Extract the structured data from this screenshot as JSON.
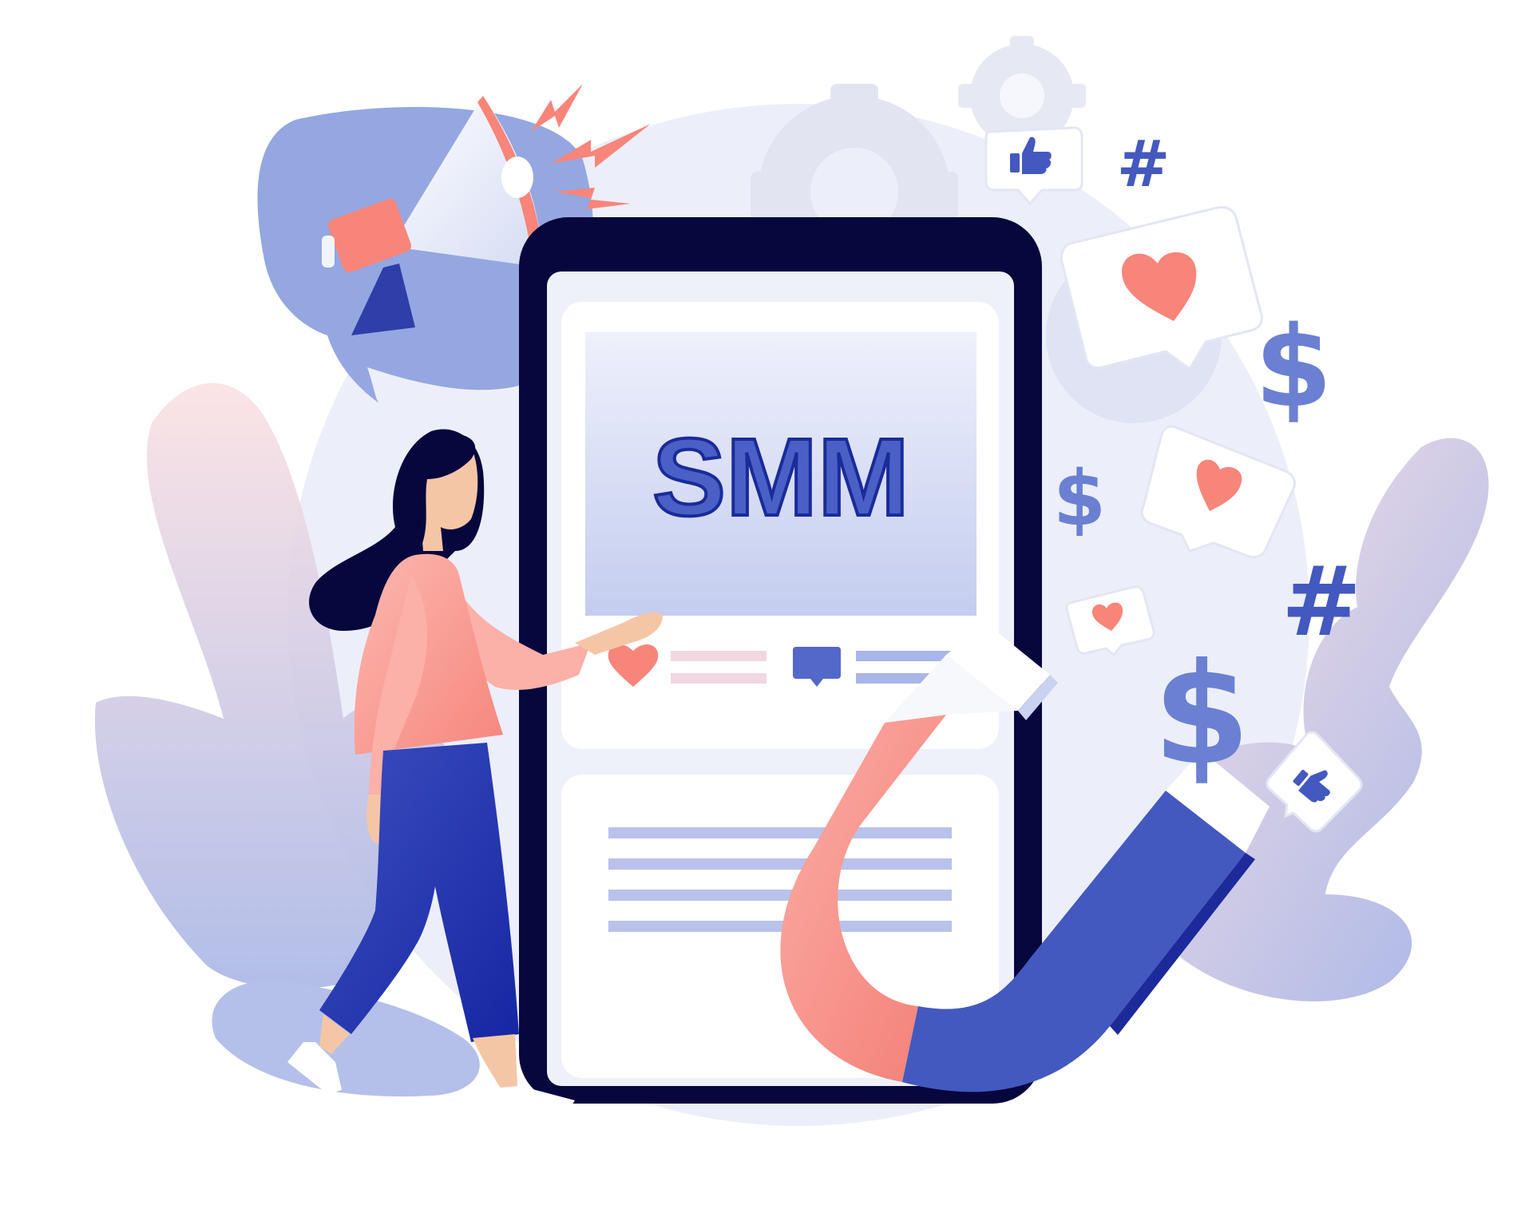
{
  "phone": {
    "title": "SMM"
  },
  "symbols": {
    "hashtag": "#",
    "dollar": "$"
  },
  "colors": {
    "navy": "#06073d",
    "blue": "#4359bf",
    "light_blue": "#97a9e2",
    "coral": "#f8857a",
    "pink": "#fbb0a8",
    "skin": "#f4c6a6",
    "pale": "#e8ecf8"
  }
}
